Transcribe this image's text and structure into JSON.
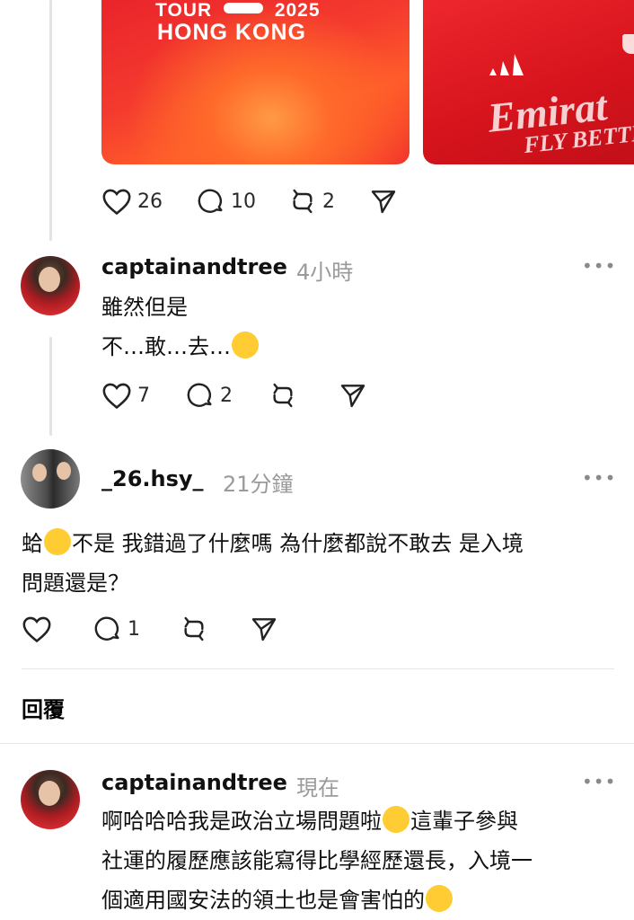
{
  "post_top": {
    "image1": {
      "line1": "TOUR",
      "line2": "2025",
      "line3": "HONG KONG"
    },
    "image2": {
      "line1": "Emirat",
      "line2": "FLY BETTE"
    },
    "likes": "26",
    "comments": "10",
    "reposts": "2"
  },
  "comment1": {
    "username": "captainandtree",
    "time": "4小時",
    "line1": "雖然但是",
    "line2": "不…敢…去…",
    "likes": "7",
    "comments": "2"
  },
  "comment2": {
    "username": "_26.hsy_",
    "time": "21分鐘",
    "text_a": "蛤",
    "text_b": "不是 我錯過了什麼嗎 為什麼都說不敢去 是入境",
    "text_c": "問題還是？",
    "comments": "1"
  },
  "reply_section": {
    "label": "回覆"
  },
  "comment3": {
    "username": "captainandtree",
    "time": "現在",
    "line1": "啊哈哈哈我是政治立場問題啦",
    "line1b": "這輩子參與",
    "line2": "社運的履歷應該能寫得比學經歷還長，入境一",
    "line3": "個適用國安法的領土也是會害怕的"
  },
  "colors": {
    "divider": "#e6e6e6",
    "muted": "#9a9a9a",
    "accent_red": "#e8212b"
  },
  "icons": [
    "heart-icon",
    "comment-icon",
    "repost-icon",
    "share-icon",
    "more-icon"
  ]
}
